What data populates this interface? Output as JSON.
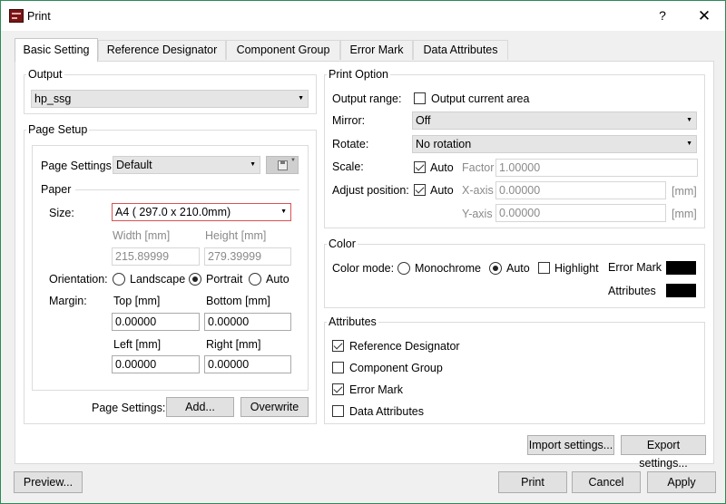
{
  "window": {
    "title": "Print",
    "help": "?",
    "close": "✕"
  },
  "tabs": [
    "Basic Setting",
    "Reference Designator",
    "Component Group",
    "Error Mark",
    "Data Attributes"
  ],
  "output": {
    "group": "Output",
    "value": "hp_ssg"
  },
  "page_setup": {
    "group": "Page Setup",
    "settings_label": "Page Settings:",
    "settings_value": "Default",
    "paper_label": "Paper",
    "size_label": "Size:",
    "size_value": "A4 ( 297.0 x 210.0mm)",
    "width_label": "Width [mm]",
    "height_label": "Height [mm]",
    "width_value": "215.89999",
    "height_value": "279.39999",
    "orientation_label": "Orientation:",
    "orientation_options": [
      "Landscape",
      "Portrait",
      "Auto"
    ],
    "orientation_selected": "Portrait",
    "margin_label": "Margin:",
    "top_label": "Top [mm]",
    "bottom_label": "Bottom [mm]",
    "left_label": "Left [mm]",
    "right_label": "Right [mm]",
    "top_value": "0.00000",
    "bottom_value": "0.00000",
    "left_value": "0.00000",
    "right_value": "0.00000",
    "footer_label": "Page Settings:",
    "add_button": "Add...",
    "overwrite_button": "Overwrite"
  },
  "print_option": {
    "group": "Print Option",
    "output_range_label": "Output range:",
    "output_current_area": "Output current area",
    "mirror_label": "Mirror:",
    "mirror_value": "Off",
    "rotate_label": "Rotate:",
    "rotate_value": "No rotation",
    "scale_label": "Scale:",
    "auto_label": "Auto",
    "factor_label": "Factor",
    "factor_value": "1.00000",
    "adjust_label": "Adjust position:",
    "xaxis_label": "X-axis",
    "yaxis_label": "Y-axis",
    "xaxis_value": "0.00000",
    "yaxis_value": "0.00000",
    "unit": "[mm]"
  },
  "color": {
    "group": "Color",
    "mode_label": "Color mode:",
    "monochrome": "Monochrome",
    "auto": "Auto",
    "highlight": "Highlight",
    "error_mark": "Error Mark",
    "attributes": "Attributes",
    "error_mark_color": "#000000",
    "attributes_color": "#000000"
  },
  "attributes": {
    "group": "Attributes",
    "items": [
      {
        "label": "Reference Designator",
        "checked": true
      },
      {
        "label": "Component Group",
        "checked": false
      },
      {
        "label": "Error Mark",
        "checked": true
      },
      {
        "label": "Data Attributes",
        "checked": false
      }
    ]
  },
  "buttons": {
    "import": "Import settings...",
    "export": "Export settings...",
    "preview": "Preview...",
    "print": "Print",
    "cancel": "Cancel",
    "apply": "Apply"
  }
}
